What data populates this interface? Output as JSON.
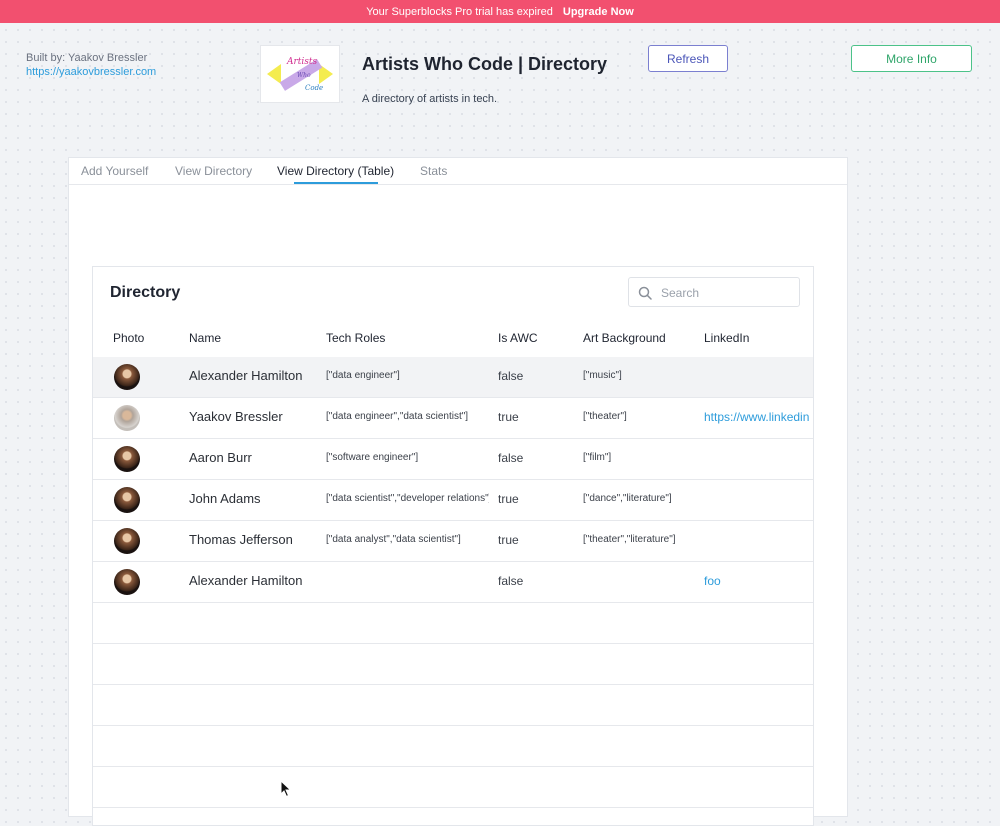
{
  "banner": {
    "text": "Your Superblocks Pro trial has expired",
    "cta": "Upgrade Now"
  },
  "author": {
    "built_by": "Built by: Yaakov Bressler",
    "url": "https://yaakovbressler.com"
  },
  "logo": {
    "line1": "Artists",
    "line2": "Who",
    "line3": "Code"
  },
  "app": {
    "title": "Artists Who Code | Directory",
    "subtitle": "A directory of artists in tech."
  },
  "buttons": {
    "refresh": "Refresh",
    "more_info": "More Info"
  },
  "tabs": [
    {
      "label": "Add Yourself"
    },
    {
      "label": "View Directory"
    },
    {
      "label": "View Directory (Table)",
      "active": true
    },
    {
      "label": "Stats"
    }
  ],
  "directory": {
    "title": "Directory",
    "search_placeholder": "Search",
    "columns": [
      "Photo",
      "Name",
      "Tech Roles",
      "Is AWC",
      "Art Background",
      "LinkedIn"
    ],
    "rows": [
      {
        "name": "Alexander Hamilton",
        "tech_roles": "[\"data engineer\"]",
        "is_awc": "false",
        "art_background": "[\"music\"]",
        "linkedin": ""
      },
      {
        "name": "Yaakov Bressler",
        "tech_roles": "[\"data engineer\",\"data scientist\"]",
        "is_awc": "true",
        "art_background": "[\"theater\"]",
        "linkedin": "https://www.linkedin"
      },
      {
        "name": "Aaron Burr",
        "tech_roles": "[\"software engineer\"]",
        "is_awc": "false",
        "art_background": "[\"film\"]",
        "linkedin": ""
      },
      {
        "name": "John Adams",
        "tech_roles": "[\"data scientist\",\"developer relations\"]",
        "is_awc": "true",
        "art_background": "[\"dance\",\"literature\"]",
        "linkedin": ""
      },
      {
        "name": "Thomas Jefferson",
        "tech_roles": "[\"data analyst\",\"data scientist\"]",
        "is_awc": "true",
        "art_background": "[\"theater\",\"literature\"]",
        "linkedin": ""
      },
      {
        "name": "Alexander Hamilton",
        "tech_roles": "",
        "is_awc": "false",
        "art_background": "",
        "linkedin": "foo"
      }
    ]
  },
  "colors": {
    "banner": "#f2506f",
    "accent": "#2d9cdb",
    "refresh_border": "#7b7fd0",
    "more_info_border": "#4cc289"
  },
  "icons": [
    "search-icon",
    "mouse-cursor-icon"
  ]
}
